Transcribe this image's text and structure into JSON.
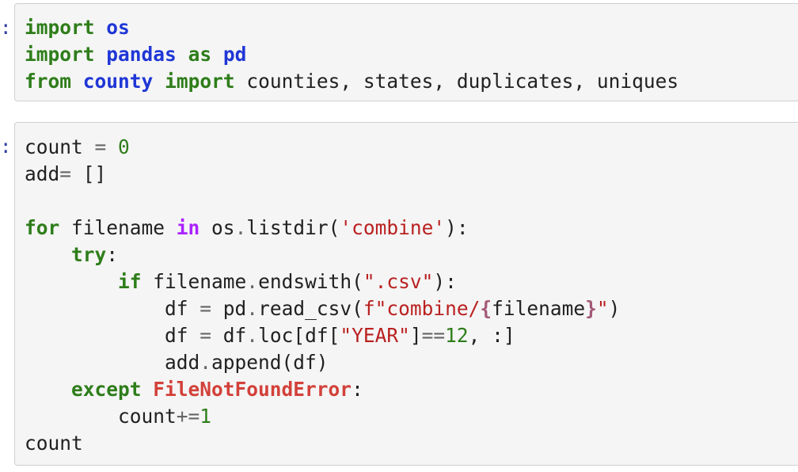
{
  "cells": [
    {
      "prompt": ":",
      "lines": [
        [
          {
            "t": "import",
            "c": "kw"
          },
          {
            "t": " "
          },
          {
            "t": "os",
            "c": "nm"
          }
        ],
        [
          {
            "t": "import",
            "c": "kw"
          },
          {
            "t": " "
          },
          {
            "t": "pandas",
            "c": "nm"
          },
          {
            "t": " "
          },
          {
            "t": "as",
            "c": "kw"
          },
          {
            "t": " "
          },
          {
            "t": "pd",
            "c": "nm"
          }
        ],
        [
          {
            "t": "from",
            "c": "kw"
          },
          {
            "t": " "
          },
          {
            "t": "county",
            "c": "nm"
          },
          {
            "t": " "
          },
          {
            "t": "import",
            "c": "kw"
          },
          {
            "t": " counties, states, duplicates, uniques"
          }
        ]
      ]
    },
    {
      "prompt": ":",
      "lines": [
        [
          {
            "t": "count "
          },
          {
            "t": "=",
            "c": "op"
          },
          {
            "t": " "
          },
          {
            "t": "0",
            "c": "num"
          }
        ],
        [
          {
            "t": "add"
          },
          {
            "t": "=",
            "c": "op"
          },
          {
            "t": " []"
          }
        ],
        [],
        [
          {
            "t": "for",
            "c": "kw"
          },
          {
            "t": " filename "
          },
          {
            "t": "in",
            "c": "wrd"
          },
          {
            "t": " os"
          },
          {
            "t": ".",
            "c": "op"
          },
          {
            "t": "listdir("
          },
          {
            "t": "'combine'",
            "c": "str"
          },
          {
            "t": "):"
          }
        ],
        [
          {
            "t": "    "
          },
          {
            "t": "try",
            "c": "kw"
          },
          {
            "t": ":"
          }
        ],
        [
          {
            "t": "        "
          },
          {
            "t": "if",
            "c": "kw"
          },
          {
            "t": " filename"
          },
          {
            "t": ".",
            "c": "op"
          },
          {
            "t": "endswith("
          },
          {
            "t": "\".csv\"",
            "c": "str"
          },
          {
            "t": "):"
          }
        ],
        [
          {
            "t": "            df "
          },
          {
            "t": "=",
            "c": "op"
          },
          {
            "t": " pd"
          },
          {
            "t": ".",
            "c": "op"
          },
          {
            "t": "read_csv("
          },
          {
            "t": "f\"combine/",
            "c": "str"
          },
          {
            "t": "{",
            "c": "intp"
          },
          {
            "t": "filename"
          },
          {
            "t": "}",
            "c": "intp"
          },
          {
            "t": "\"",
            "c": "str"
          },
          {
            "t": ")"
          }
        ],
        [
          {
            "t": "            df "
          },
          {
            "t": "=",
            "c": "op"
          },
          {
            "t": " df"
          },
          {
            "t": ".",
            "c": "op"
          },
          {
            "t": "loc[df["
          },
          {
            "t": "\"YEAR\"",
            "c": "str"
          },
          {
            "t": "]"
          },
          {
            "t": "==",
            "c": "op"
          },
          {
            "t": "12",
            "c": "num"
          },
          {
            "t": ", :]"
          }
        ],
        [
          {
            "t": "            add"
          },
          {
            "t": ".",
            "c": "op"
          },
          {
            "t": "append(df)"
          }
        ],
        [
          {
            "t": "    "
          },
          {
            "t": "except",
            "c": "kw"
          },
          {
            "t": " "
          },
          {
            "t": "FileNotFoundError",
            "c": "exc"
          },
          {
            "t": ":"
          }
        ],
        [
          {
            "t": "        count"
          },
          {
            "t": "+=",
            "c": "op"
          },
          {
            "t": "1",
            "c": "num"
          }
        ],
        [
          {
            "t": "count"
          }
        ]
      ]
    }
  ]
}
